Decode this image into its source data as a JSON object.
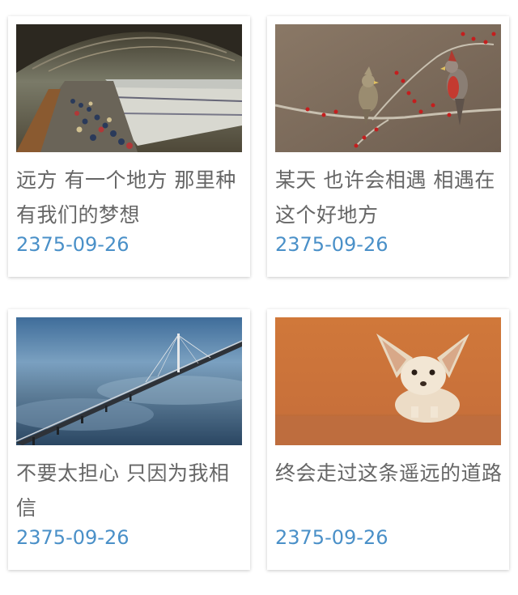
{
  "cards": [
    {
      "title": "远方 有一个地方 那里种有我们的梦想",
      "date": "2375-09-26",
      "image": "train-station-photo"
    },
    {
      "title": "某天 也许会相遇 相遇在这个好地方",
      "date": "2375-09-26",
      "image": "birds-on-branch-photo"
    },
    {
      "title": "不要太担心 只因为我相信",
      "date": "2375-09-26",
      "image": "bridge-over-fog-photo"
    },
    {
      "title": "终会走过这条遥远的道路",
      "date": "2375-09-26",
      "image": "fennec-fox-photo"
    }
  ],
  "colors": {
    "title_text": "#666666",
    "date_text": "#4a90c8"
  }
}
